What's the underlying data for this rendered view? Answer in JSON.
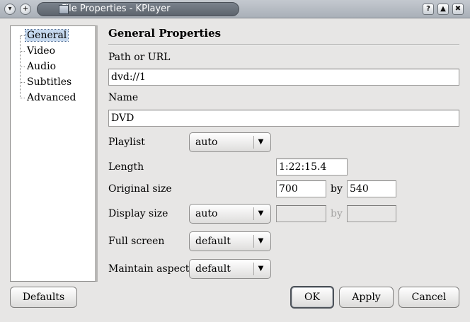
{
  "window": {
    "title": "File Properties - KPlayer",
    "menu_btn": "▾",
    "sticky_btn": "+",
    "help_btn": "?",
    "maximize_btn": "▲",
    "close_btn": "✖"
  },
  "tree": {
    "items": [
      "General",
      "Video",
      "Audio",
      "Subtitles",
      "Advanced"
    ],
    "selected": "General"
  },
  "section_title": "General Properties",
  "fields": {
    "path_label": "Path or URL",
    "path_value": "dvd://1",
    "name_label": "Name",
    "name_value": "DVD",
    "playlist_label": "Playlist",
    "playlist_value": "auto",
    "length_label": "Length",
    "length_value": "1:22:15.4",
    "original_size_label": "Original size",
    "original_width": "700",
    "original_by": "by",
    "original_height": "540",
    "display_size_label": "Display size",
    "display_size_value": "auto",
    "display_by": "by",
    "full_screen_label": "Full screen",
    "full_screen_value": "default",
    "maintain_aspect_label": "Maintain aspect",
    "maintain_aspect_value": "default"
  },
  "buttons": {
    "defaults": "Defaults",
    "ok": "OK",
    "apply": "Apply",
    "cancel": "Cancel"
  },
  "icons": {
    "combo_arrow": "▼"
  }
}
